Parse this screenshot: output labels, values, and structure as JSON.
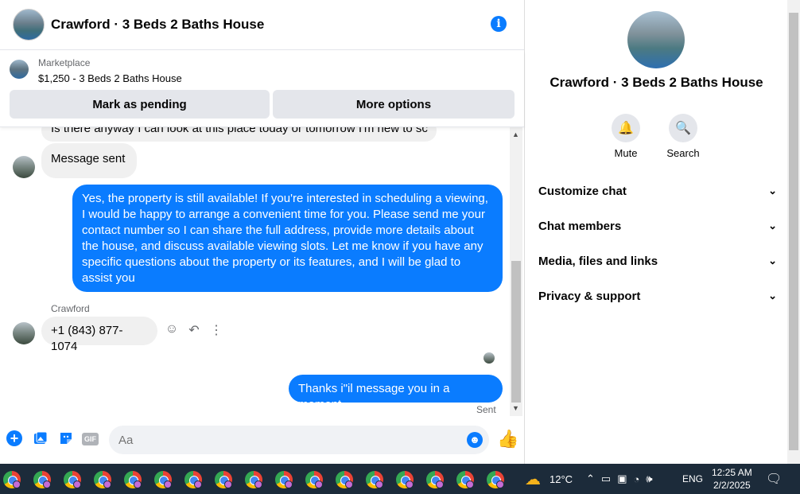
{
  "chat": {
    "title": "Crawford · 3 Beds 2 Baths House",
    "info_icon": "i",
    "marketplace": {
      "label": "Marketplace",
      "price_title": "$1,250 - 3 Beds 2 Baths House",
      "pending_button": "Mark as pending",
      "more_button": "More options"
    },
    "messages": {
      "cut_incoming": "Is there anyway I can look at this place today or tomorrow I'm new to sc",
      "sent_incoming": "Message sent",
      "long_outgoing": "Yes, the property is still available! If you're interested in scheduling a viewing, I would be happy to arrange a convenient time for you. Please send me your contact number so I can share the full address, provide more details about the house, and discuss available viewing slots. Let me know if you have any specific questions about the property or its features, and I will be glad to assist you",
      "sender_name": "Crawford",
      "phone": "+1 (843) 877-1074",
      "thanks": "Thanks i\"il message you in a moment",
      "status": "Sent"
    },
    "composer": {
      "placeholder": "Aa",
      "gif_label": "GIF"
    }
  },
  "info": {
    "title": "Crawford · 3 Beds 2 Baths House",
    "mute_label": "Mute",
    "search_label": "Search",
    "sections": [
      "Customize chat",
      "Chat members",
      "Media, files and links",
      "Privacy & support"
    ]
  },
  "taskbar": {
    "temperature": "12°C",
    "language": "ENG",
    "time": "12:25 AM",
    "date": "2/2/2025",
    "app_icons": [
      "chrome-icon",
      "chrome-icon",
      "chrome-icon",
      "chrome-icon",
      "chrome-icon",
      "chrome-icon",
      "chrome-icon",
      "chrome-icon",
      "chrome-icon",
      "chrome-icon",
      "chrome-icon",
      "chrome-icon",
      "chrome-icon",
      "chrome-icon",
      "chrome-icon",
      "chrome-icon",
      "chrome-icon"
    ]
  },
  "colors": {
    "accent": "#0a7cff",
    "incoming_bubble": "#f0f0f0",
    "taskbar": "#1c2b3a"
  }
}
